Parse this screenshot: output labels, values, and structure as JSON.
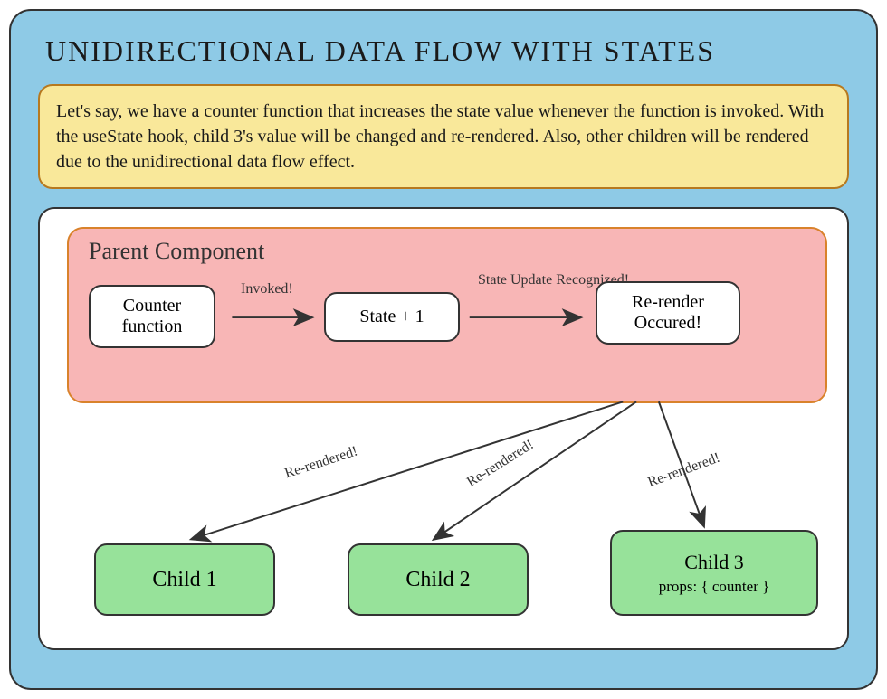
{
  "title": "UNIDIRECTIONAL DATA FLOW WITH STATES",
  "explanation": "Let's say, we have a counter function that increases the state value whenever the function is invoked. With the useState hook, child 3's value will be changed and re-rendered. Also, other children will be rendered due to the unidirectional data flow effect.",
  "parent": {
    "label": "Parent Component",
    "nodes": {
      "counter": "Counter function",
      "state": "State + 1",
      "rerender": "Re-render Occured!"
    },
    "arrows": {
      "invoked": "Invoked!",
      "state_update": "State Update Recognized!"
    }
  },
  "children": {
    "c1": {
      "label": "Child 1",
      "edge": "Re-rendered!"
    },
    "c2": {
      "label": "Child 2",
      "edge": "Re-rendered!"
    },
    "c3": {
      "label": "Child 3",
      "sub": "props: { counter }",
      "edge": "Re-rendered!"
    }
  },
  "colors": {
    "outer_bg": "#8ecae6",
    "explain_bg": "#f9e89a",
    "parent_bg": "#f8b6b6",
    "child_bg": "#97e29a",
    "stroke": "#333333"
  }
}
